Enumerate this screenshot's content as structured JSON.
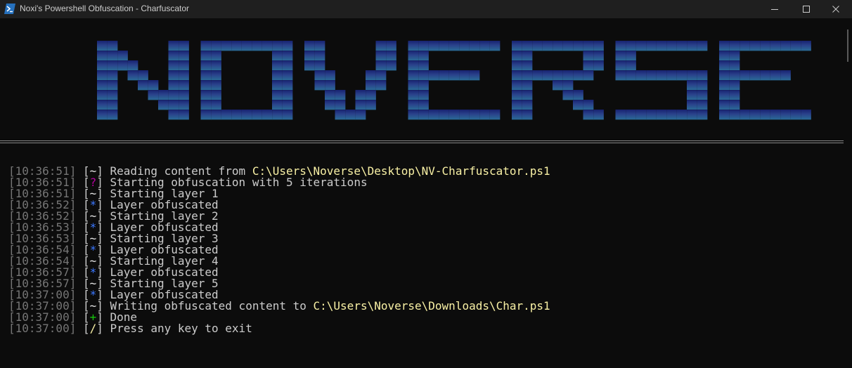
{
  "window": {
    "title": "Noxi's Powershell Obfuscation - Charfuscator",
    "controls": [
      "minimize",
      "maximize",
      "close"
    ]
  },
  "banner": {
    "text": "NOVERSE",
    "colors": {
      "top": "#1e2ea6",
      "middle": "#3a5fd0",
      "bottom": "#3a9ee0"
    }
  },
  "symbol_colors": {
    "~": "#e8e8e8",
    "?": "#b4009e",
    "*": "#3b78ff",
    "+": "#16c60c",
    "/": "#f9f1a5"
  },
  "console": {
    "lines": [
      {
        "timestamp": "[10:36:51]",
        "symbol": "~",
        "message": "Reading content from ",
        "path": "C:\\Users\\Noverse\\Desktop\\NV-Charfuscator.ps1"
      },
      {
        "timestamp": "[10:36:51]",
        "symbol": "?",
        "message": "Starting obfuscation with 5 iterations"
      },
      {
        "timestamp": "[10:36:51]",
        "symbol": "~",
        "message": "Starting layer 1"
      },
      {
        "timestamp": "[10:36:52]",
        "symbol": "*",
        "message": "Layer obfuscated"
      },
      {
        "timestamp": "[10:36:52]",
        "symbol": "~",
        "message": "Starting layer 2"
      },
      {
        "timestamp": "[10:36:53]",
        "symbol": "*",
        "message": "Layer obfuscated"
      },
      {
        "timestamp": "[10:36:53]",
        "symbol": "~",
        "message": "Starting layer 3"
      },
      {
        "timestamp": "[10:36:54]",
        "symbol": "*",
        "message": "Layer obfuscated"
      },
      {
        "timestamp": "[10:36:54]",
        "symbol": "~",
        "message": "Starting layer 4"
      },
      {
        "timestamp": "[10:36:57]",
        "symbol": "*",
        "message": "Layer obfuscated"
      },
      {
        "timestamp": "[10:36:57]",
        "symbol": "~",
        "message": "Starting layer 5"
      },
      {
        "timestamp": "[10:37:00]",
        "symbol": "*",
        "message": "Layer obfuscated"
      },
      {
        "timestamp": "[10:37:00]",
        "symbol": "~",
        "message": "Writing obfuscated content to ",
        "path": "C:\\Users\\Noverse\\Downloads\\Char.ps1"
      },
      {
        "timestamp": "[10:37:00]",
        "symbol": "+",
        "message": "Done"
      },
      {
        "timestamp": "[10:37:00]",
        "symbol": "/",
        "message": "Press any key to exit"
      }
    ]
  }
}
